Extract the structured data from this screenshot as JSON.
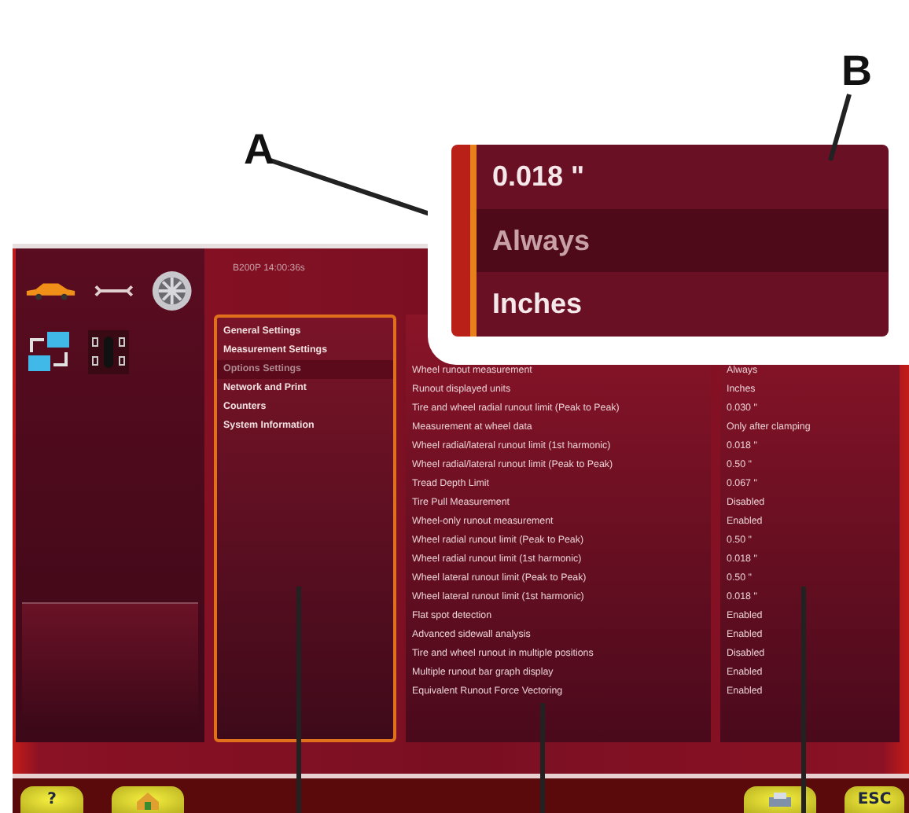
{
  "header": {
    "status": "B200P  14:00:36s"
  },
  "menu": [
    {
      "label": "General Settings",
      "selected": false
    },
    {
      "label": "Measurement Settings",
      "selected": false
    },
    {
      "label": "Options Settings",
      "selected": true
    },
    {
      "label": "Network and Print",
      "selected": false
    },
    {
      "label": "Counters",
      "selected": false
    },
    {
      "label": "System Information",
      "selected": false
    }
  ],
  "settings": [
    {
      "name": "Wheel runout measurement",
      "value": "Always"
    },
    {
      "name": "Runout displayed units",
      "value": "Inches"
    },
    {
      "name": "Tire and wheel radial runout limit (Peak to Peak)",
      "value": "0.030 \""
    },
    {
      "name": "Measurement at wheel data",
      "value": "Only after clamping"
    },
    {
      "name": "Wheel radial/lateral runout limit (1st harmonic)",
      "value": "0.018 \""
    },
    {
      "name": "Wheel radial/lateral runout limit (Peak to Peak)",
      "value": "0.50 \""
    },
    {
      "name": "Tread Depth Limit",
      "value": "0.067 \""
    },
    {
      "name": "Tire Pull Measurement",
      "value": "Disabled"
    },
    {
      "name": "Wheel-only runout measurement",
      "value": "Enabled"
    },
    {
      "name": "Wheel radial runout limit (Peak to Peak)",
      "value": "0.50 \""
    },
    {
      "name": "Wheel radial runout limit (1st harmonic)",
      "value": "0.018 \""
    },
    {
      "name": "Wheel lateral runout limit (Peak to Peak)",
      "value": "0.50 \""
    },
    {
      "name": "Wheel lateral runout limit (1st harmonic)",
      "value": "0.018 \""
    },
    {
      "name": "Flat spot detection",
      "value": "Enabled"
    },
    {
      "name": "Advanced sidewall analysis",
      "value": "Enabled"
    },
    {
      "name": "Tire and wheel runout in multiple positions",
      "value": "Disabled"
    },
    {
      "name": "Multiple runout bar graph display",
      "value": "Enabled"
    },
    {
      "name": "Equivalent Runout Force Vectoring",
      "value": "Enabled"
    }
  ],
  "footer": [
    {
      "kind": "help",
      "label": "?"
    },
    {
      "kind": "home"
    },
    {
      "kind": "spacer"
    },
    {
      "kind": "print"
    },
    {
      "kind": "esc",
      "label": "ESC"
    }
  ],
  "callout": {
    "rows": [
      {
        "value": "0.018 \"",
        "selected": false
      },
      {
        "value": "Always",
        "selected": true
      },
      {
        "value": "Inches",
        "selected": false
      }
    ]
  },
  "annotations": [
    {
      "label": "A"
    },
    {
      "label": "B"
    }
  ]
}
